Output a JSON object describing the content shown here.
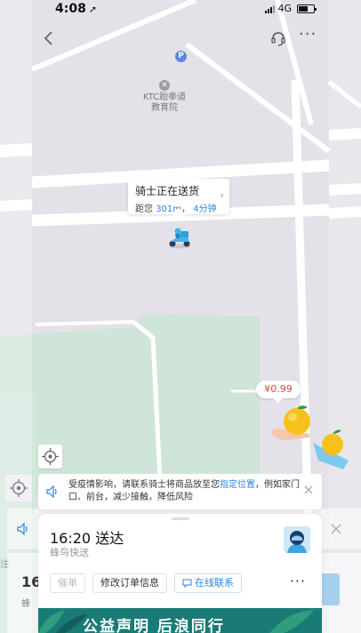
{
  "status_bar": {
    "time": "4:08",
    "location_arrow": "➚",
    "network": "4G"
  },
  "nav": {
    "back_icon": "chevron-left-icon",
    "support_icon": "headset-icon",
    "more_label": "···"
  },
  "map": {
    "parking_label": "P",
    "poi_name": "KTC跆拳道教育院",
    "colors": {
      "background": "#e4e2e8",
      "road": "#ffffff",
      "park": "#cfe5d9"
    }
  },
  "rider_status": {
    "title": "骑士正在送货",
    "chevron": "›",
    "distance_prefix": "距您",
    "distance": "301m",
    "separator": "，",
    "eta_minutes": "4分钟"
  },
  "price_tag": "¥0.99",
  "notice": {
    "text_before": "受疫情影响，请联系骑士将商品放至您",
    "highlight": "指定位置",
    "text_after": "，例如家门口、前台，减少接触，降低风险"
  },
  "ghost": {
    "eta_partial": "16",
    "company_partial": "蜂",
    "side_text": "注"
  },
  "order": {
    "eta": "16:20 送达",
    "company": "蜂鸟快送"
  },
  "actions": {
    "receipt": "催单",
    "modify": "修改订单信息",
    "contact": "在线联系",
    "more": "···"
  },
  "banner": {
    "text": "公益声明 后浪同行"
  }
}
